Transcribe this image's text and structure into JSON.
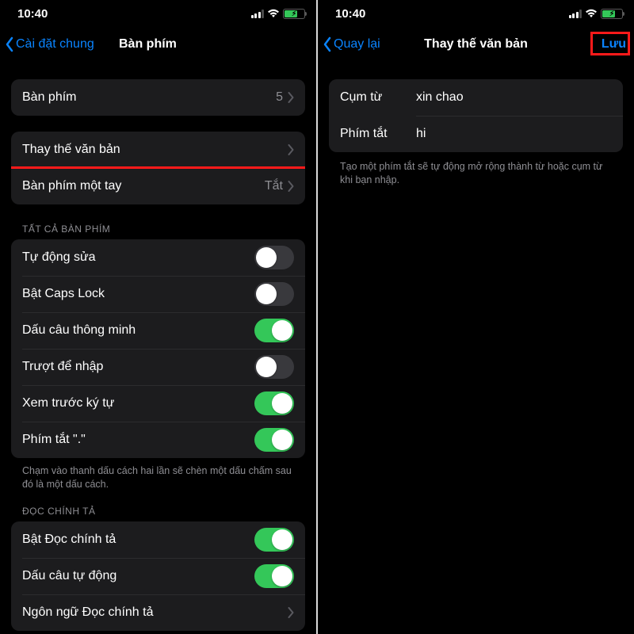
{
  "left": {
    "status": {
      "time": "10:40"
    },
    "nav": {
      "back": "Cài đặt chung",
      "title": "Bàn phím"
    },
    "rows": {
      "keyboards": {
        "label": "Bàn phím",
        "detail": "5"
      },
      "text_replace": {
        "label": "Thay thế văn bản"
      },
      "one_hand": {
        "label": "Bàn phím một tay",
        "detail": "Tắt"
      }
    },
    "section_all": "TẤT CẢ BÀN PHÍM",
    "toggles": {
      "auto_correct": {
        "label": "Tự động sửa",
        "on": false
      },
      "caps_lock": {
        "label": "Bật Caps Lock",
        "on": false
      },
      "smart_punct": {
        "label": "Dấu câu thông minh",
        "on": true
      },
      "slide_type": {
        "label": "Trượt để nhập",
        "on": false
      },
      "char_preview": {
        "label": "Xem trước ký tự",
        "on": true
      },
      "period_shortcut": {
        "label": "Phím tắt \".\"",
        "on": true
      }
    },
    "footer_all": "Chạm vào thanh dấu cách hai lần sẽ chèn một dấu chấm sau đó là một dấu cách.",
    "section_dict": "ĐỌC CHÍNH TẢ",
    "dict": {
      "enable": {
        "label": "Bật Đọc chính tả",
        "on": true
      },
      "auto_punct": {
        "label": "Dấu câu tự động",
        "on": true
      },
      "lang": {
        "label": "Ngôn ngữ Đọc chính tả"
      }
    }
  },
  "right": {
    "status": {
      "time": "10:40"
    },
    "nav": {
      "back": "Quay lại",
      "title": "Thay thế văn bản",
      "action": "Lưu"
    },
    "form": {
      "phrase_label": "Cụm từ",
      "phrase_value": "xin chao",
      "shortcut_label": "Phím tắt",
      "shortcut_value": "hi"
    },
    "footer": "Tạo một phím tắt sẽ tự động mở rộng thành từ hoặc cụm từ khi bạn nhập."
  }
}
